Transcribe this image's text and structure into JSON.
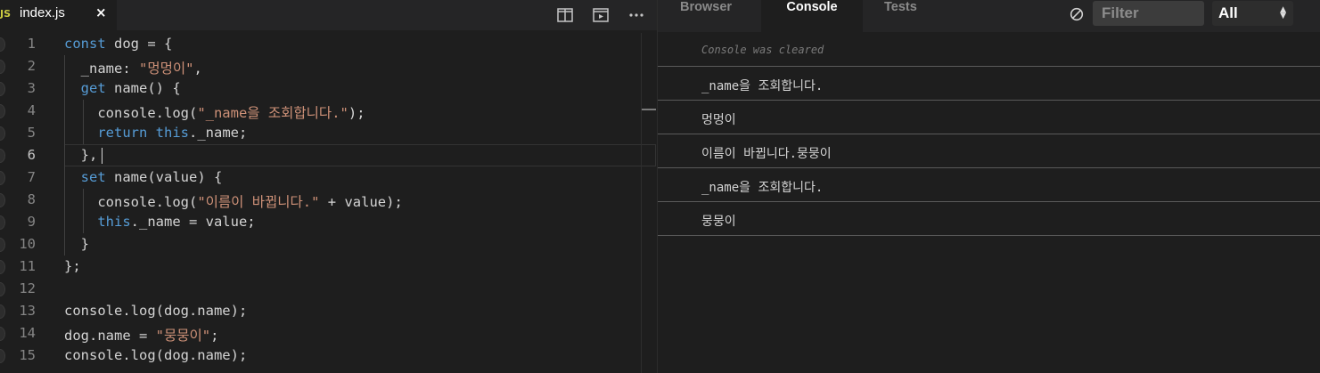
{
  "editor": {
    "tab": {
      "icon_label": "JS",
      "filename": "index.js",
      "close_glyph": "×"
    },
    "toolbar_icons": [
      "split-editor-icon",
      "preview-icon",
      "more-icon"
    ],
    "active_line": 6,
    "lines": [
      {
        "n": "1",
        "tokens": [
          [
            "kw",
            "const"
          ],
          [
            "pl",
            " dog = {"
          ]
        ]
      },
      {
        "n": "2",
        "tokens": [
          [
            "pl",
            "  _name: "
          ],
          [
            "str",
            "\"멍멍이\""
          ],
          [
            "pl",
            ","
          ]
        ]
      },
      {
        "n": "3",
        "tokens": [
          [
            "pl",
            "  "
          ],
          [
            "kw",
            "get"
          ],
          [
            "pl",
            " name() {"
          ]
        ]
      },
      {
        "n": "4",
        "tokens": [
          [
            "pl",
            "    console.log("
          ],
          [
            "str",
            "\"_name을 조회합니다.\""
          ],
          [
            "pl",
            ");"
          ]
        ]
      },
      {
        "n": "5",
        "tokens": [
          [
            "pl",
            "    "
          ],
          [
            "kw",
            "return"
          ],
          [
            "pl",
            " "
          ],
          [
            "kw",
            "this"
          ],
          [
            "pl",
            "._name;"
          ]
        ]
      },
      {
        "n": "6",
        "tokens": [
          [
            "pl",
            "  },"
          ]
        ]
      },
      {
        "n": "7",
        "tokens": [
          [
            "pl",
            "  "
          ],
          [
            "kw",
            "set"
          ],
          [
            "pl",
            " name(value) {"
          ]
        ]
      },
      {
        "n": "8",
        "tokens": [
          [
            "pl",
            "    console.log("
          ],
          [
            "str",
            "\"이름이 바뀝니다.\""
          ],
          [
            "pl",
            " + value);"
          ]
        ]
      },
      {
        "n": "9",
        "tokens": [
          [
            "pl",
            "    "
          ],
          [
            "kw",
            "this"
          ],
          [
            "pl",
            "._name = value;"
          ]
        ]
      },
      {
        "n": "10",
        "tokens": [
          [
            "pl",
            "  }"
          ]
        ]
      },
      {
        "n": "11",
        "tokens": [
          [
            "pl",
            "};"
          ]
        ]
      },
      {
        "n": "12",
        "tokens": []
      },
      {
        "n": "13",
        "tokens": [
          [
            "pl",
            "console.log(dog.name);"
          ]
        ]
      },
      {
        "n": "14",
        "tokens": [
          [
            "pl",
            "dog.name = "
          ],
          [
            "str",
            "\"뭉뭉이\""
          ],
          [
            "pl",
            ";"
          ]
        ]
      },
      {
        "n": "15",
        "tokens": [
          [
            "pl",
            "console.log(dog.name);"
          ]
        ]
      }
    ]
  },
  "console": {
    "tabs": [
      {
        "label": "Browser",
        "active": false
      },
      {
        "label": "Console",
        "active": true
      },
      {
        "label": "Tests",
        "active": false
      }
    ],
    "filter_placeholder": "Filter",
    "level": "All",
    "entries": [
      {
        "text": "Console was cleared",
        "type": "info"
      },
      {
        "text": "_name을 조회합니다.",
        "type": "log"
      },
      {
        "text": "멍멍이",
        "type": "log"
      },
      {
        "text": "이름이 바뀝니다.뭉뭉이",
        "type": "log"
      },
      {
        "text": "_name을 조회합니다.",
        "type": "log"
      },
      {
        "text": "뭉뭉이",
        "type": "log"
      }
    ]
  },
  "colors": {
    "background": "#1e1e1e",
    "keyword": "#569cd6",
    "string": "#ce9178",
    "text": "#d4d4d4",
    "js_badge": "#cbcb41"
  }
}
